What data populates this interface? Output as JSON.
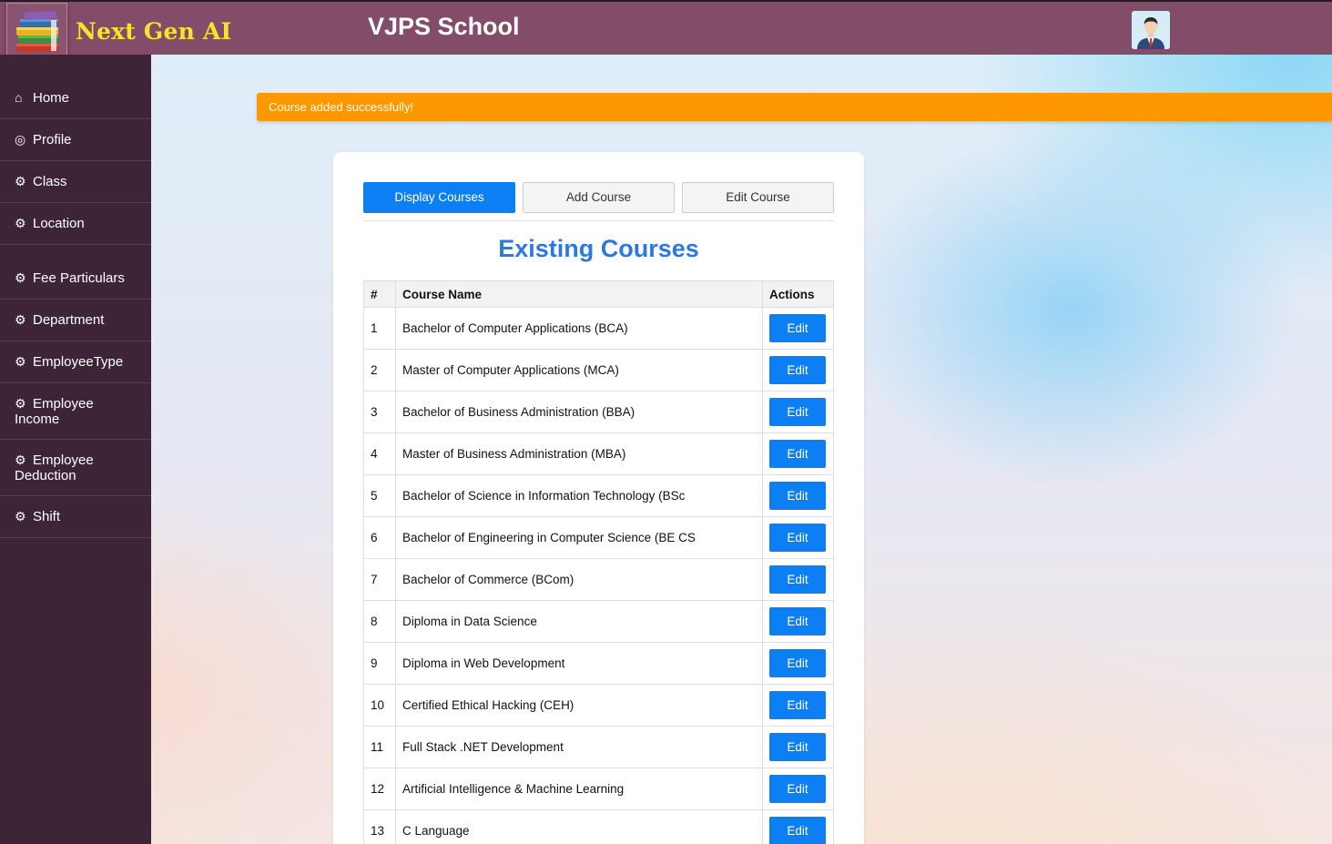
{
  "header": {
    "brand": "Next Gen AI",
    "school_name": "VJPS School"
  },
  "sidebar": {
    "items": [
      {
        "label": "Home",
        "icon": "home-icon"
      },
      {
        "label": "Profile",
        "icon": "user-circle-icon"
      },
      {
        "label": "Class",
        "icon": "gear-icon"
      },
      {
        "label": "Location",
        "icon": "gear-icon"
      },
      {
        "label": "Fee Particulars",
        "icon": "gear-icon"
      },
      {
        "label": "Department",
        "icon": "gear-icon"
      },
      {
        "label": "EmployeeType",
        "icon": "gear-icon"
      },
      {
        "label": "Employee Income",
        "icon": "gear-icon"
      },
      {
        "label": "Employee Deduction",
        "icon": "gear-icon"
      },
      {
        "label": "Shift",
        "icon": "gear-icon"
      }
    ]
  },
  "alert": {
    "message": "Course added successfully!",
    "color": "#ff9800"
  },
  "tabs": [
    {
      "label": "Display Courses",
      "active": true
    },
    {
      "label": "Add Course",
      "active": false
    },
    {
      "label": "Edit Course",
      "active": false
    }
  ],
  "section_title": "Existing Courses",
  "table": {
    "headers": [
      "#",
      "Course Name",
      "Actions"
    ],
    "action_label": "Edit",
    "rows": [
      {
        "num": "1",
        "name": "Bachelor of Computer Applications (BCA)"
      },
      {
        "num": "2",
        "name": "Master of Computer Applications (MCA)"
      },
      {
        "num": "3",
        "name": "Bachelor of Business Administration (BBA)"
      },
      {
        "num": "4",
        "name": "Master of Business Administration (MBA)"
      },
      {
        "num": "5",
        "name": "Bachelor of Science in Information Technology (BSc"
      },
      {
        "num": "6",
        "name": "Bachelor of Engineering in Computer Science (BE CS"
      },
      {
        "num": "7",
        "name": "Bachelor of Commerce (BCom)"
      },
      {
        "num": "8",
        "name": "Diploma in Data Science"
      },
      {
        "num": "9",
        "name": "Diploma in Web Development"
      },
      {
        "num": "10",
        "name": "Certified Ethical Hacking (CEH)"
      },
      {
        "num": "11",
        "name": "Full Stack .NET Development"
      },
      {
        "num": "12",
        "name": "Artificial Intelligence & Machine Learning"
      },
      {
        "num": "13",
        "name": "C Language"
      }
    ]
  },
  "colors": {
    "header_bg": "#834d69",
    "sidebar_bg": "#3d2436",
    "brand_text": "#f2e52a",
    "primary": "#0d7ff5",
    "heading": "#2b78e4"
  }
}
